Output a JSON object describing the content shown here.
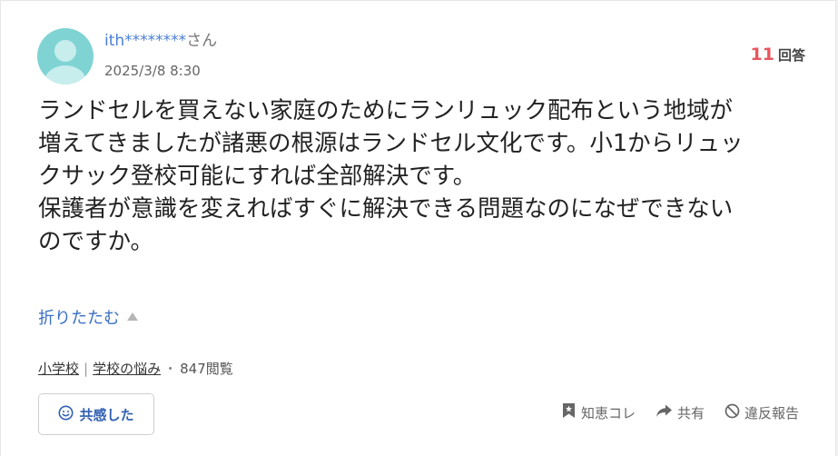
{
  "post": {
    "username": "ith********",
    "username_suffix": "さん",
    "date": "2025/3/8 8:30",
    "answer_count": "11",
    "answer_label": "回答",
    "body_lines": [
      "ランドセルを買えない家庭のためにランリュック配布という地域が",
      "増えてきましたが諸悪の根源はランドセル文化です。小1からリュッ",
      "クサック登校可能にすれば全部解決です。",
      "保護者が意識を変えればすぐに解決できる問題なのになぜできない",
      "のですか。"
    ],
    "collapse_label": "折りたたむ",
    "tags": [
      "小学校",
      "学校の悩み"
    ],
    "tag_separator": "|",
    "view_separator": "・",
    "views": "847閲覧"
  },
  "actions": {
    "empathy_label": "共感した",
    "bookmark_label": "知恵コレ",
    "share_label": "共有",
    "report_label": "違反報告"
  },
  "icons": {
    "avatar": "user-avatar-icon",
    "empathy": "smile-icon",
    "bookmark": "bookmark-icon",
    "share": "share-arrow-icon",
    "report": "prohibited-icon"
  },
  "colors": {
    "link_blue": "#3a6fc4",
    "answer_count_red": "#e8565c",
    "avatar_teal": "#7fd3d3"
  }
}
